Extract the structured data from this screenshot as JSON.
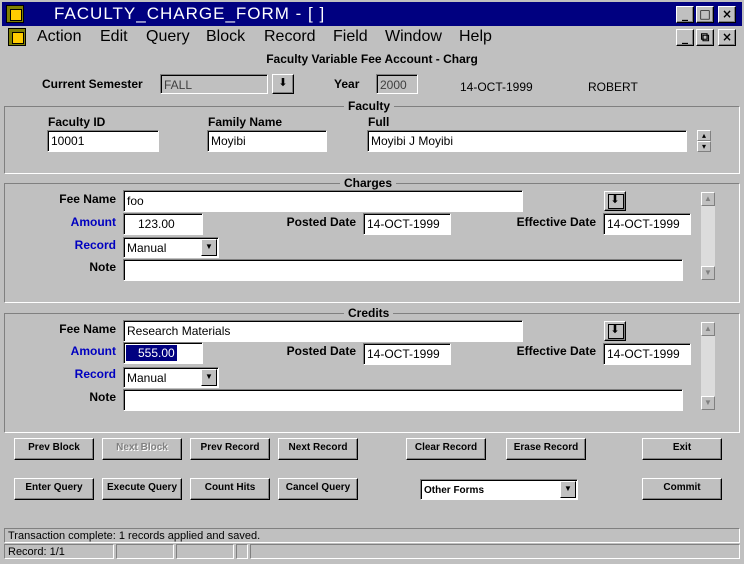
{
  "window": {
    "title": "FACULTY_CHARGE_FORM - [ ]",
    "minimize": "_",
    "maximize": "□",
    "close": "×",
    "doc_minimize": "_",
    "doc_restore": "⧉",
    "doc_close": "×"
  },
  "menu": [
    "Action",
    "Edit",
    "Query",
    "Block",
    "Record",
    "Field",
    "Window",
    "Help"
  ],
  "form": {
    "heading": "Faculty Variable Fee Account - Charg",
    "semester_label": "Current Semester",
    "semester_value": "FALL",
    "year_label": "Year",
    "year_value": "2000",
    "date": "14-OCT-1999",
    "user": "ROBERT"
  },
  "faculty": {
    "title": "Faculty",
    "id_label": "Faculty ID",
    "id_value": "10001",
    "family_label": "Family Name",
    "family_value": "Moyibi",
    "full_label": "Full",
    "full_value": "Moyibi J Moyibi"
  },
  "charges": {
    "title": "Charges",
    "fee_name_label": "Fee Name",
    "fee_name_value": "foo",
    "amount_label": "Amount",
    "amount_value": "123.00",
    "posted_label": "Posted Date",
    "posted_value": "14-OCT-1999",
    "effective_label": "Effective Date",
    "effective_value": "14-OCT-1999",
    "record_label": "Record",
    "record_value": "Manual",
    "note_label": "Note",
    "note_value": ""
  },
  "credits": {
    "title": "Credits",
    "fee_name_label": "Fee Name",
    "fee_name_value": "Research Materials",
    "amount_label": "Amount",
    "amount_value": "555.00",
    "posted_label": "Posted Date",
    "posted_value": "14-OCT-1999",
    "effective_label": "Effective Date",
    "effective_value": "14-OCT-1999",
    "record_label": "Record",
    "record_value": "Manual",
    "note_label": "Note",
    "note_value": ""
  },
  "buttons": {
    "prev_block": "Prev Block",
    "next_block": "Next Block",
    "prev_record": "Prev Record",
    "next_record": "Next Record",
    "clear_record": "Clear Record",
    "erase_record": "Erase Record",
    "exit": "Exit",
    "enter_query": "Enter Query",
    "execute_query": "Execute Query",
    "count_hits": "Count Hits",
    "cancel_query": "Cancel Query",
    "other_forms": "Other Forms",
    "commit": "Commit"
  },
  "status": {
    "message": "Transaction complete: 1 records applied and saved.",
    "record": "Record: 1/1"
  }
}
